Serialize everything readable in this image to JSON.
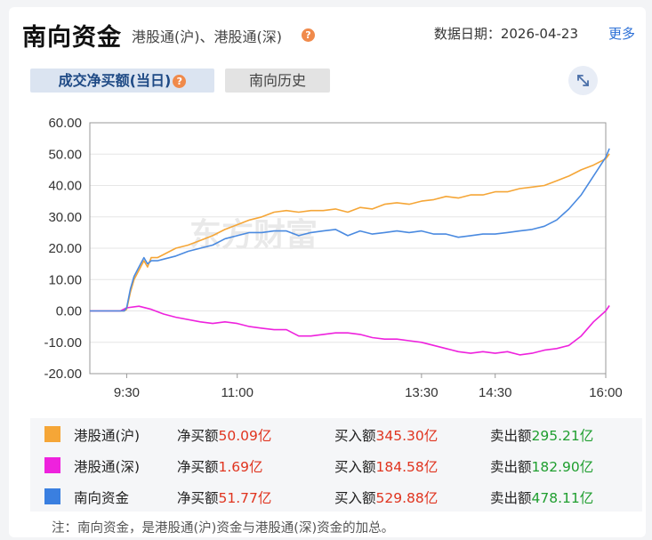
{
  "header": {
    "title": "南向资金",
    "subtitle": "港股通(沪)、港股通(深)",
    "help_icon": "?",
    "date_label": "数据日期：2026-04-23",
    "more_label": "更多"
  },
  "tabs": [
    {
      "label": "成交净买额(当日)",
      "active": true
    },
    {
      "label": "南向历史",
      "active": false
    }
  ],
  "watermark": "东方财富",
  "chart_data": {
    "type": "line",
    "yticks": [
      "60.00",
      "50.00",
      "40.00",
      "30.00",
      "20.00",
      "10.00",
      "0.00",
      "-10.00",
      "-20.00"
    ],
    "ylim": [
      -20,
      60
    ],
    "xticks": [
      "9:30",
      "11:00",
      "13:30",
      "14:30",
      "16:00"
    ],
    "x_minutes": [
      0,
      90,
      240,
      300,
      390
    ],
    "xlim": [
      -30,
      390
    ],
    "series": [
      {
        "name": "港股通(沪)",
        "color": "#f5a637",
        "points": [
          [
            -30,
            0
          ],
          [
            -2,
            0
          ],
          [
            0,
            0.5
          ],
          [
            3,
            6
          ],
          [
            6,
            10
          ],
          [
            10,
            13
          ],
          [
            14,
            16
          ],
          [
            17,
            14
          ],
          [
            20,
            17
          ],
          [
            25,
            17
          ],
          [
            30,
            18
          ],
          [
            40,
            20
          ],
          [
            50,
            21
          ],
          [
            60,
            22.5
          ],
          [
            70,
            24
          ],
          [
            80,
            26
          ],
          [
            90,
            27.5
          ],
          [
            100,
            29
          ],
          [
            110,
            30
          ],
          [
            120,
            31.5
          ],
          [
            130,
            32
          ],
          [
            140,
            31.5
          ],
          [
            150,
            32
          ],
          [
            160,
            32
          ],
          [
            170,
            32.5
          ],
          [
            180,
            31.5
          ],
          [
            190,
            33
          ],
          [
            200,
            32.5
          ],
          [
            210,
            34
          ],
          [
            220,
            34.5
          ],
          [
            230,
            34
          ],
          [
            240,
            35
          ],
          [
            250,
            35.5
          ],
          [
            260,
            36.5
          ],
          [
            270,
            36
          ],
          [
            280,
            37
          ],
          [
            290,
            37
          ],
          [
            300,
            38
          ],
          [
            310,
            38
          ],
          [
            320,
            39
          ],
          [
            330,
            39.5
          ],
          [
            340,
            40
          ],
          [
            350,
            41.5
          ],
          [
            360,
            43
          ],
          [
            370,
            45
          ],
          [
            380,
            46.5
          ],
          [
            390,
            48.5
          ],
          [
            393,
            50.09
          ]
        ]
      },
      {
        "name": "港股通(深)",
        "color": "#ee22dd",
        "points": [
          [
            -30,
            0
          ],
          [
            -5,
            0
          ],
          [
            0,
            1
          ],
          [
            10,
            1.5
          ],
          [
            20,
            0.5
          ],
          [
            30,
            -1
          ],
          [
            40,
            -2
          ],
          [
            60,
            -3.5
          ],
          [
            70,
            -4
          ],
          [
            80,
            -3.5
          ],
          [
            90,
            -4
          ],
          [
            100,
            -5
          ],
          [
            110,
            -5.5
          ],
          [
            120,
            -6
          ],
          [
            130,
            -6
          ],
          [
            140,
            -8
          ],
          [
            150,
            -8
          ],
          [
            160,
            -7.5
          ],
          [
            170,
            -7
          ],
          [
            180,
            -7
          ],
          [
            190,
            -7.5
          ],
          [
            200,
            -8.5
          ],
          [
            210,
            -9
          ],
          [
            220,
            -9
          ],
          [
            230,
            -9.5
          ],
          [
            240,
            -10
          ],
          [
            250,
            -11
          ],
          [
            260,
            -12
          ],
          [
            270,
            -13
          ],
          [
            280,
            -13.5
          ],
          [
            290,
            -13
          ],
          [
            300,
            -13.5
          ],
          [
            310,
            -13
          ],
          [
            320,
            -14
          ],
          [
            330,
            -13.5
          ],
          [
            340,
            -12.5
          ],
          [
            350,
            -12
          ],
          [
            360,
            -11
          ],
          [
            370,
            -8
          ],
          [
            380,
            -3.5
          ],
          [
            390,
            0
          ],
          [
            393,
            1.69
          ]
        ]
      },
      {
        "name": "南向资金",
        "color": "#4a8ae0",
        "points": [
          [
            -30,
            0
          ],
          [
            -2,
            0
          ],
          [
            0,
            1
          ],
          [
            3,
            7
          ],
          [
            6,
            11
          ],
          [
            10,
            14
          ],
          [
            14,
            17
          ],
          [
            17,
            15
          ],
          [
            20,
            16
          ],
          [
            25,
            16
          ],
          [
            30,
            16.5
          ],
          [
            40,
            17.5
          ],
          [
            50,
            19
          ],
          [
            60,
            20
          ],
          [
            70,
            21
          ],
          [
            80,
            23
          ],
          [
            90,
            24
          ],
          [
            100,
            25
          ],
          [
            110,
            25
          ],
          [
            120,
            25.5
          ],
          [
            130,
            25.5
          ],
          [
            140,
            24
          ],
          [
            150,
            25
          ],
          [
            160,
            25.5
          ],
          [
            170,
            26
          ],
          [
            180,
            24
          ],
          [
            190,
            25.5
          ],
          [
            200,
            24.5
          ],
          [
            210,
            25
          ],
          [
            220,
            25.5
          ],
          [
            230,
            25
          ],
          [
            240,
            25.5
          ],
          [
            250,
            24.5
          ],
          [
            260,
            24.5
          ],
          [
            270,
            23.5
          ],
          [
            280,
            24
          ],
          [
            290,
            24.5
          ],
          [
            300,
            24.5
          ],
          [
            310,
            25
          ],
          [
            320,
            25.5
          ],
          [
            330,
            26
          ],
          [
            340,
            27
          ],
          [
            350,
            29
          ],
          [
            360,
            32.5
          ],
          [
            370,
            37
          ],
          [
            380,
            43
          ],
          [
            390,
            49
          ],
          [
            393,
            51.77
          ]
        ]
      }
    ]
  },
  "legend": [
    {
      "color": "#f5a637",
      "name": "港股通(沪)",
      "net_label": "净买额",
      "net_value": "50.09亿",
      "buy_label": "买入额",
      "buy_value": "345.30亿",
      "sell_label": "卖出额",
      "sell_value": "295.21亿"
    },
    {
      "color": "#ee22dd",
      "name": "港股通(深)",
      "net_label": "净买额",
      "net_value": "1.69亿",
      "buy_label": "买入额",
      "buy_value": "184.58亿",
      "sell_label": "卖出额",
      "sell_value": "182.90亿"
    },
    {
      "color": "#3a7fe0",
      "name": "南向资金",
      "net_label": "净买额",
      "net_value": "51.77亿",
      "buy_label": "买入额",
      "buy_value": "529.88亿",
      "sell_label": "卖出额",
      "sell_value": "478.11亿"
    }
  ],
  "note": "注：南向资金，是港股通(沪)资金与港股通(深)资金的加总。"
}
